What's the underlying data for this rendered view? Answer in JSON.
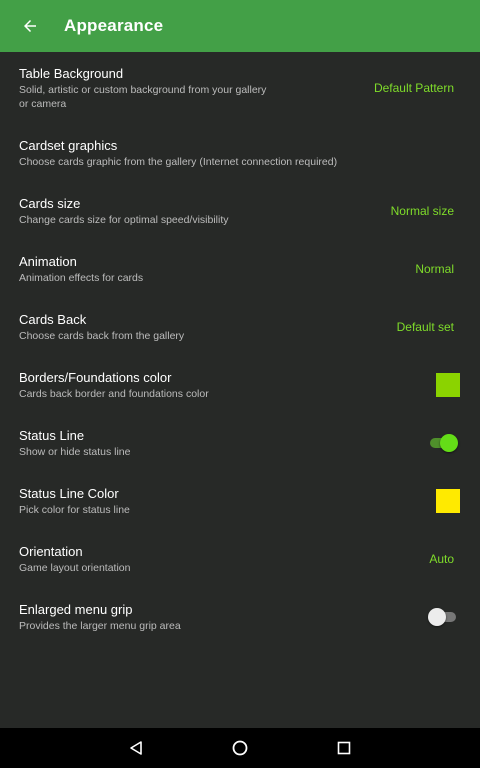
{
  "appbar": {
    "title": "Appearance",
    "background": "#43a047",
    "back_icon": "arrow-back-icon"
  },
  "accent_color": "#7fdc2a",
  "settings": [
    {
      "title": "Table Background",
      "subtitle": "Solid, artistic or custom background from your gallery or camera",
      "value": "Default Pattern"
    },
    {
      "title": "Cardset graphics",
      "subtitle": "Choose cards graphic from the gallery (Internet connection required)"
    },
    {
      "title": "Cards size",
      "subtitle": "Change cards size for optimal speed/visibility",
      "value": "Normal size"
    },
    {
      "title": "Animation",
      "subtitle": "Animation effects for cards",
      "value": "Normal"
    },
    {
      "title": "Cards Back",
      "subtitle": "Choose cards back from the gallery",
      "value": "Default set"
    },
    {
      "title": "Borders/Foundations color",
      "subtitle": "Cards back border and foundations color",
      "swatch_color": "#8bd300"
    },
    {
      "title": "Status Line",
      "subtitle": "Show or hide status line",
      "switch_on": true
    },
    {
      "title": "Status Line Color",
      "subtitle": "Pick color for status line",
      "swatch_color": "#ffea00"
    },
    {
      "title": "Orientation",
      "subtitle": "Game layout orientation",
      "value": "Auto"
    },
    {
      "title": "Enlarged menu grip",
      "subtitle": "Provides the larger menu grip area",
      "switch_on": false
    }
  ],
  "navbar": {
    "back_icon": "nav-back-icon",
    "home_icon": "nav-home-icon",
    "recents_icon": "nav-recents-icon"
  }
}
